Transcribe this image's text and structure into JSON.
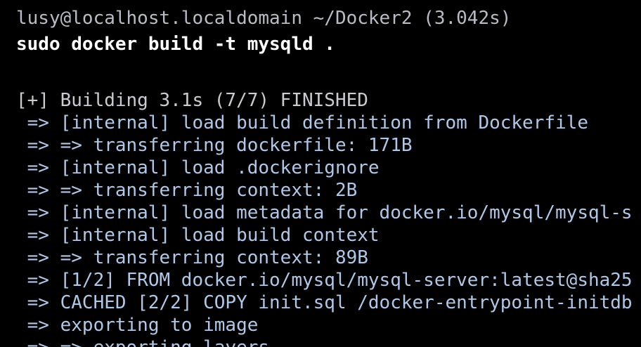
{
  "prompt": {
    "text": "lusy@localhost.localdomain ~/Docker2 (3.042s)"
  },
  "command": {
    "text": "sudo docker build -t mysqld ."
  },
  "output": {
    "header": "[+] Building 3.1s (7/7) FINISHED",
    "lines": [
      " => [internal] load build definition from Dockerfile",
      " => => transferring dockerfile: 171B",
      " => [internal] load .dockerignore",
      " => => transferring context: 2B",
      " => [internal] load metadata for docker.io/mysql/mysql-s",
      " => [internal] load build context",
      " => => transferring context: 89B",
      " => [1/2] FROM docker.io/mysql/mysql-server:latest@sha25",
      " => CACHED [2/2] COPY init.sql /docker-entrypoint-initdb",
      " => exporting to image",
      " => => exporting layers"
    ]
  },
  "colors": {
    "background": "#000000",
    "prompt": "#b9bcc4",
    "command": "#ffffff",
    "output": "#b0c8e8"
  }
}
